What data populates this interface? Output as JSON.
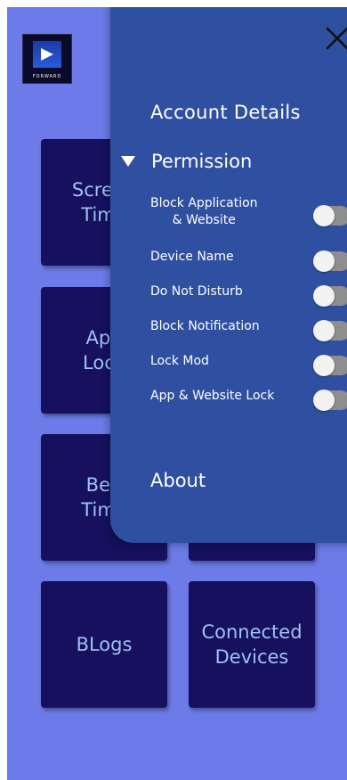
{
  "app": {
    "logo_text": "FORWARD"
  },
  "tiles": [
    {
      "label": "Screen\nTime"
    },
    {
      "label": "App\nLock"
    },
    {
      "label": "Bed\nTime"
    },
    {
      "label": ""
    },
    {
      "label": "BLogs"
    },
    {
      "label": "Connected\nDevices"
    }
  ],
  "drawer": {
    "account_details": "Account Details",
    "permission": "Permission",
    "permissions": [
      {
        "label": "Block Application\n& Website",
        "enabled": false
      },
      {
        "label": "Device Name",
        "enabled": false
      },
      {
        "label": "Do Not Disturb",
        "enabled": false
      },
      {
        "label": "Block Notification",
        "enabled": false
      },
      {
        "label": "Lock Mod",
        "enabled": false
      },
      {
        "label": "App & Website Lock",
        "enabled": false
      }
    ],
    "about": "About"
  },
  "colors": {
    "background": "#6d7be8",
    "tile": "#16105e",
    "tile_text": "#9fc3ef",
    "drawer": "#2f4fa0",
    "toggle_track": "#8e8e8e"
  }
}
